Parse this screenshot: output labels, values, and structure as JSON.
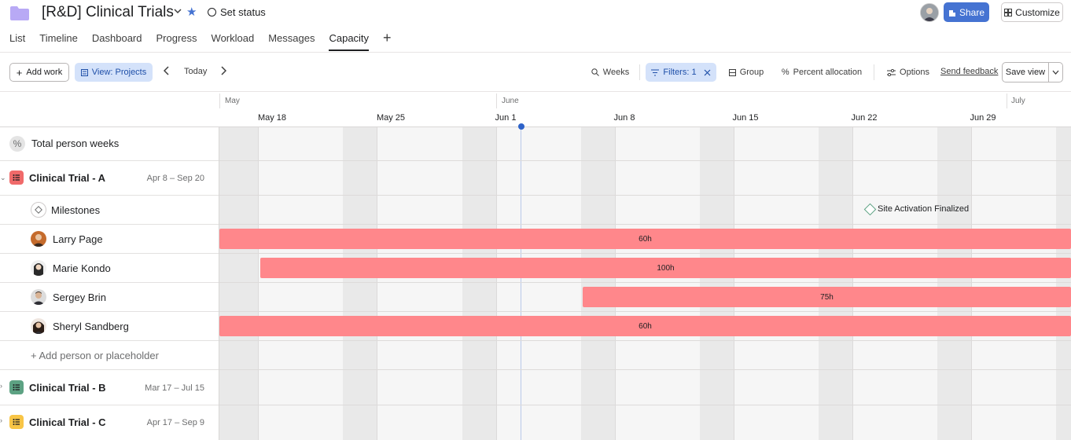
{
  "header": {
    "title": "[R&D] Clinical Trials",
    "set_status": "Set status",
    "share": "Share",
    "customize": "Customize"
  },
  "tabs": [
    "List",
    "Timeline",
    "Dashboard",
    "Progress",
    "Workload",
    "Messages",
    "Capacity"
  ],
  "tab_plus": "+",
  "toolbar": {
    "add_work": "Add work",
    "view_projects": "View: Projects",
    "today": "Today",
    "weeks": "Weeks",
    "filters": "Filters: 1",
    "group": "Group",
    "percent_allocation": "Percent allocation",
    "options": "Options",
    "send_feedback": "Send feedback",
    "save_view": "Save view"
  },
  "timeline": {
    "months": [
      "May",
      "June",
      "July"
    ],
    "weeks": [
      "May 18",
      "May 25",
      "Jun 1",
      "Jun 8",
      "Jun 15",
      "Jun 22",
      "Jun 29"
    ]
  },
  "rows": {
    "total": "Total person weeks",
    "projects": [
      {
        "name": "Clinical Trial - A",
        "dates": "Apr 8 – Sep 20",
        "color": "#f06a6a"
      },
      {
        "name": "Clinical Trial - B",
        "dates": "Mar 17 – Jul 15",
        "color": "#5da283"
      },
      {
        "name": "Clinical Trial - C",
        "dates": "Apr 17 – Sep 9",
        "color": "#f8c546"
      }
    ],
    "milestones": "Milestones",
    "milestone_label": "Site Activation Finalized",
    "people": [
      {
        "name": "Larry Page",
        "hours": "60h"
      },
      {
        "name": "Marie Kondo",
        "hours": "100h"
      },
      {
        "name": "Sergey Brin",
        "hours": "75h"
      },
      {
        "name": "Sheryl Sandberg",
        "hours": "60h"
      }
    ],
    "add_person": "+ Add person or placeholder"
  },
  "colors": {
    "accent": "#4573d2",
    "bar": "#ff878b",
    "highlight_bg": "#d4e2fa"
  }
}
